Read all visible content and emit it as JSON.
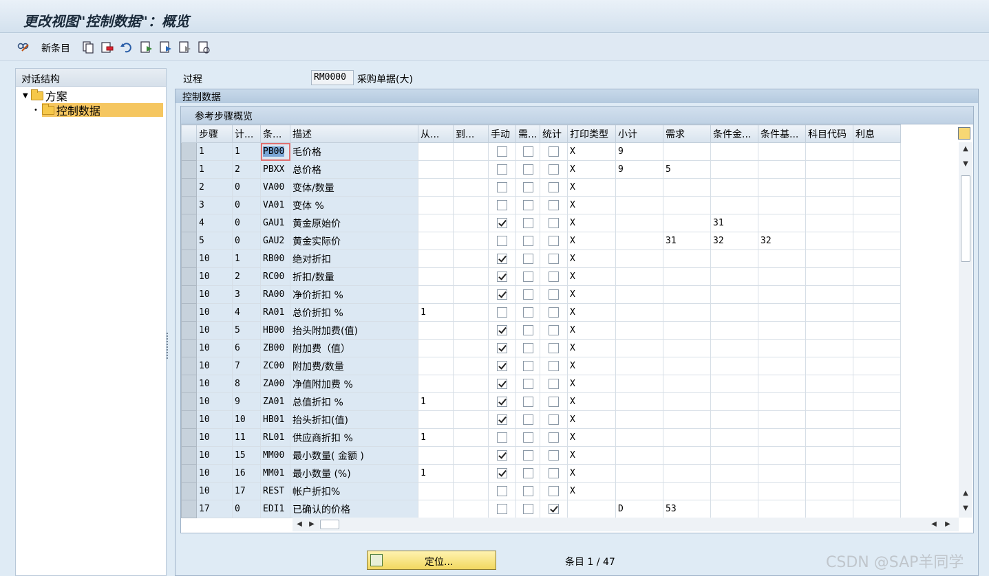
{
  "window": {
    "title": "更改视图\"控制数据\"：概览"
  },
  "toolbar": {
    "new_entries_label": "新条目"
  },
  "dialog_structure": {
    "header": "对话结构",
    "nodes": [
      {
        "label": "方案"
      },
      {
        "label": "控制数据"
      }
    ]
  },
  "procedure": {
    "label": "过程",
    "value": "RM0000",
    "description": "采购单据(大)"
  },
  "control_data": {
    "group_title": "控制数据",
    "table_title": "参考步骤概览"
  },
  "table": {
    "columns": [
      "步骤",
      "计...",
      "条...",
      "描述",
      "从...",
      "到...",
      "手动",
      "需...",
      "统计",
      "打印类型",
      "小计",
      "需求",
      "条件金...",
      "条件基...",
      "科目代码",
      "利息"
    ],
    "rows": [
      {
        "step": "1",
        "counter": "1",
        "ctype": "PB00",
        "desc": "毛价格",
        "from": "",
        "to": "",
        "manual": false,
        "req": false,
        "stat": false,
        "print": "X",
        "subtotal": "9",
        "requirement": "",
        "cond_amt": "",
        "cond_base": "",
        "acct": "",
        "accr": ""
      },
      {
        "step": "1",
        "counter": "2",
        "ctype": "PBXX",
        "desc": "总价格",
        "from": "",
        "to": "",
        "manual": false,
        "req": false,
        "stat": false,
        "print": "X",
        "subtotal": "9",
        "requirement": "5",
        "cond_amt": "",
        "cond_base": "",
        "acct": "",
        "accr": ""
      },
      {
        "step": "2",
        "counter": "0",
        "ctype": "VA00",
        "desc": "变体/数量",
        "from": "",
        "to": "",
        "manual": false,
        "req": false,
        "stat": false,
        "print": "X",
        "subtotal": "",
        "requirement": "",
        "cond_amt": "",
        "cond_base": "",
        "acct": "",
        "accr": ""
      },
      {
        "step": "3",
        "counter": "0",
        "ctype": "VA01",
        "desc": "变体 %",
        "from": "",
        "to": "",
        "manual": false,
        "req": false,
        "stat": false,
        "print": "X",
        "subtotal": "",
        "requirement": "",
        "cond_amt": "",
        "cond_base": "",
        "acct": "",
        "accr": ""
      },
      {
        "step": "4",
        "counter": "0",
        "ctype": "GAU1",
        "desc": "黄金原始价",
        "from": "",
        "to": "",
        "manual": true,
        "req": false,
        "stat": false,
        "print": "X",
        "subtotal": "",
        "requirement": "",
        "cond_amt": "31",
        "cond_base": "",
        "acct": "",
        "accr": ""
      },
      {
        "step": "5",
        "counter": "0",
        "ctype": "GAU2",
        "desc": "黄金实际价",
        "from": "",
        "to": "",
        "manual": false,
        "req": false,
        "stat": false,
        "print": "X",
        "subtotal": "",
        "requirement": "31",
        "cond_amt": "32",
        "cond_base": "32",
        "acct": "",
        "accr": ""
      },
      {
        "step": "10",
        "counter": "1",
        "ctype": "RB00",
        "desc": "绝对折扣",
        "from": "",
        "to": "",
        "manual": true,
        "req": false,
        "stat": false,
        "print": "X",
        "subtotal": "",
        "requirement": "",
        "cond_amt": "",
        "cond_base": "",
        "acct": "",
        "accr": ""
      },
      {
        "step": "10",
        "counter": "2",
        "ctype": "RC00",
        "desc": "折扣/数量",
        "from": "",
        "to": "",
        "manual": true,
        "req": false,
        "stat": false,
        "print": "X",
        "subtotal": "",
        "requirement": "",
        "cond_amt": "",
        "cond_base": "",
        "acct": "",
        "accr": ""
      },
      {
        "step": "10",
        "counter": "3",
        "ctype": "RA00",
        "desc": "净价折扣 %",
        "from": "",
        "to": "",
        "manual": true,
        "req": false,
        "stat": false,
        "print": "X",
        "subtotal": "",
        "requirement": "",
        "cond_amt": "",
        "cond_base": "",
        "acct": "",
        "accr": ""
      },
      {
        "step": "10",
        "counter": "4",
        "ctype": "RA01",
        "desc": "总价折扣 %",
        "from": "1",
        "to": "",
        "manual": false,
        "req": false,
        "stat": false,
        "print": "X",
        "subtotal": "",
        "requirement": "",
        "cond_amt": "",
        "cond_base": "",
        "acct": "",
        "accr": ""
      },
      {
        "step": "10",
        "counter": "5",
        "ctype": "HB00",
        "desc": "抬头附加费(值)",
        "from": "",
        "to": "",
        "manual": true,
        "req": false,
        "stat": false,
        "print": "X",
        "subtotal": "",
        "requirement": "",
        "cond_amt": "",
        "cond_base": "",
        "acct": "",
        "accr": ""
      },
      {
        "step": "10",
        "counter": "6",
        "ctype": "ZB00",
        "desc": "附加费（值）",
        "from": "",
        "to": "",
        "manual": true,
        "req": false,
        "stat": false,
        "print": "X",
        "subtotal": "",
        "requirement": "",
        "cond_amt": "",
        "cond_base": "",
        "acct": "",
        "accr": ""
      },
      {
        "step": "10",
        "counter": "7",
        "ctype": "ZC00",
        "desc": "附加费/数量",
        "from": "",
        "to": "",
        "manual": true,
        "req": false,
        "stat": false,
        "print": "X",
        "subtotal": "",
        "requirement": "",
        "cond_amt": "",
        "cond_base": "",
        "acct": "",
        "accr": ""
      },
      {
        "step": "10",
        "counter": "8",
        "ctype": "ZA00",
        "desc": "净值附加费 %",
        "from": "",
        "to": "",
        "manual": true,
        "req": false,
        "stat": false,
        "print": "X",
        "subtotal": "",
        "requirement": "",
        "cond_amt": "",
        "cond_base": "",
        "acct": "",
        "accr": ""
      },
      {
        "step": "10",
        "counter": "9",
        "ctype": "ZA01",
        "desc": "总值折扣 %",
        "from": "1",
        "to": "",
        "manual": true,
        "req": false,
        "stat": false,
        "print": "X",
        "subtotal": "",
        "requirement": "",
        "cond_amt": "",
        "cond_base": "",
        "acct": "",
        "accr": ""
      },
      {
        "step": "10",
        "counter": "10",
        "ctype": "HB01",
        "desc": "抬头折扣(值)",
        "from": "",
        "to": "",
        "manual": true,
        "req": false,
        "stat": false,
        "print": "X",
        "subtotal": "",
        "requirement": "",
        "cond_amt": "",
        "cond_base": "",
        "acct": "",
        "accr": ""
      },
      {
        "step": "10",
        "counter": "11",
        "ctype": "RL01",
        "desc": "供应商折扣 %",
        "from": "1",
        "to": "",
        "manual": false,
        "req": false,
        "stat": false,
        "print": "X",
        "subtotal": "",
        "requirement": "",
        "cond_amt": "",
        "cond_base": "",
        "acct": "",
        "accr": ""
      },
      {
        "step": "10",
        "counter": "15",
        "ctype": "MM00",
        "desc": "最小数量( 金额 )",
        "from": "",
        "to": "",
        "manual": true,
        "req": false,
        "stat": false,
        "print": "X",
        "subtotal": "",
        "requirement": "",
        "cond_amt": "",
        "cond_base": "",
        "acct": "",
        "accr": ""
      },
      {
        "step": "10",
        "counter": "16",
        "ctype": "MM01",
        "desc": "最小数量 (%)",
        "from": "1",
        "to": "",
        "manual": true,
        "req": false,
        "stat": false,
        "print": "X",
        "subtotal": "",
        "requirement": "",
        "cond_amt": "",
        "cond_base": "",
        "acct": "",
        "accr": ""
      },
      {
        "step": "10",
        "counter": "17",
        "ctype": "REST",
        "desc": "帐户折扣%",
        "from": "",
        "to": "",
        "manual": false,
        "req": false,
        "stat": false,
        "print": "X",
        "subtotal": "",
        "requirement": "",
        "cond_amt": "",
        "cond_base": "",
        "acct": "",
        "accr": ""
      },
      {
        "step": "17",
        "counter": "0",
        "ctype": "EDI1",
        "desc": "已确认的价格",
        "from": "",
        "to": "",
        "manual": false,
        "req": false,
        "stat": true,
        "print": "",
        "subtotal": "D",
        "requirement": "53",
        "cond_amt": "",
        "cond_base": "",
        "acct": "",
        "accr": ""
      }
    ]
  },
  "footer": {
    "position_button": "定位...",
    "entry_info": "条目 1 / 47"
  },
  "watermark": "CSDN @SAP羊同学"
}
